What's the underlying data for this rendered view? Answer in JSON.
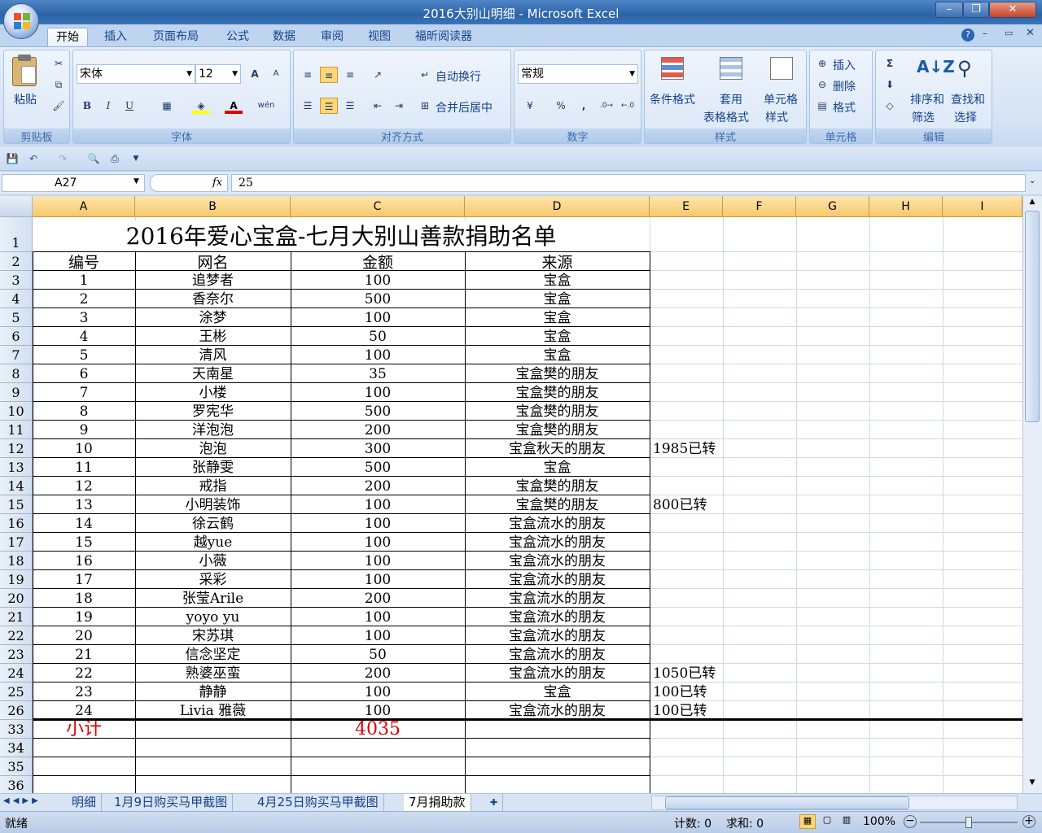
{
  "window": {
    "title": "2016大别山明细 - Microsoft Excel"
  },
  "ribbon_tabs": [
    "开始",
    "插入",
    "页面布局",
    "公式",
    "数据",
    "审阅",
    "视图",
    "福昕阅读器"
  ],
  "ribbon": {
    "clipboard": {
      "label": "剪贴板",
      "paste": "粘贴"
    },
    "font": {
      "label": "字体",
      "name": "宋体",
      "size": "12",
      "bold": "B",
      "italic": "I",
      "underline": "U",
      "grow": "A",
      "shrink": "A",
      "phonetic": "wén"
    },
    "align": {
      "label": "对齐方式",
      "wrap": "自动换行",
      "merge": "合并后居中"
    },
    "number": {
      "label": "数字",
      "format": "常规",
      "percent": "%",
      "comma": ","
    },
    "styles": {
      "label": "样式",
      "cond": "条件格式",
      "table1": "套用",
      "table2": "表格格式",
      "cell1": "单元格",
      "cell2": "样式"
    },
    "cells": {
      "label": "单元格",
      "insert": "插入",
      "delete": "删除",
      "format": "格式"
    },
    "edit": {
      "label": "编辑",
      "sort1": "排序和",
      "sort2": "筛选",
      "find1": "查找和",
      "find2": "选择",
      "sigma": "Σ"
    }
  },
  "formula_bar": {
    "name_box": "A27",
    "fx": "fx",
    "value": "25"
  },
  "columns": [
    "A",
    "B",
    "C",
    "D",
    "E",
    "F",
    "G",
    "H",
    "I"
  ],
  "sheet": {
    "title": "2016年爱心宝盒-七月大别山善款捐助名单",
    "headers": [
      "编号",
      "网名",
      "金额",
      "来源"
    ],
    "rows": [
      {
        "row": "3",
        "no": "1",
        "name": "追梦者",
        "amount": "100",
        "source": "宝盒",
        "note": ""
      },
      {
        "row": "4",
        "no": "2",
        "name": "香奈尔",
        "amount": "500",
        "source": "宝盒",
        "note": ""
      },
      {
        "row": "5",
        "no": "3",
        "name": "涂梦",
        "amount": "100",
        "source": "宝盒",
        "note": ""
      },
      {
        "row": "6",
        "no": "4",
        "name": "王彬",
        "amount": "50",
        "source": "宝盒",
        "note": ""
      },
      {
        "row": "7",
        "no": "5",
        "name": "清风",
        "amount": "100",
        "source": "宝盒",
        "note": ""
      },
      {
        "row": "8",
        "no": "6",
        "name": "天南星",
        "amount": "35",
        "source": "宝盒樊的朋友",
        "note": ""
      },
      {
        "row": "9",
        "no": "7",
        "name": "小楼",
        "amount": "100",
        "source": "宝盒樊的朋友",
        "note": ""
      },
      {
        "row": "10",
        "no": "8",
        "name": "罗宪华",
        "amount": "500",
        "source": "宝盒樊的朋友",
        "note": ""
      },
      {
        "row": "11",
        "no": "9",
        "name": "洋泡泡",
        "amount": "200",
        "source": "宝盒樊的朋友",
        "note": ""
      },
      {
        "row": "12",
        "no": "10",
        "name": "泡泡",
        "amount": "300",
        "source": "宝盒秋天的朋友",
        "note": "1985已转"
      },
      {
        "row": "13",
        "no": "11",
        "name": "张静雯",
        "amount": "500",
        "source": "宝盒",
        "note": ""
      },
      {
        "row": "14",
        "no": "12",
        "name": "戒指",
        "amount": "200",
        "source": "宝盒樊的朋友",
        "note": ""
      },
      {
        "row": "15",
        "no": "13",
        "name": "小明装饰",
        "amount": "100",
        "source": "宝盒樊的朋友",
        "note": "800已转"
      },
      {
        "row": "16",
        "no": "14",
        "name": "徐云鹤",
        "amount": "100",
        "source": "宝盒流水的朋友",
        "note": ""
      },
      {
        "row": "17",
        "no": "15",
        "name": "越yue",
        "amount": "100",
        "source": "宝盒流水的朋友",
        "note": ""
      },
      {
        "row": "18",
        "no": "16",
        "name": "小薇",
        "amount": "100",
        "source": "宝盒流水的朋友",
        "note": ""
      },
      {
        "row": "19",
        "no": "17",
        "name": "采彩",
        "amount": "100",
        "source": "宝盒流水的朋友",
        "note": ""
      },
      {
        "row": "20",
        "no": "18",
        "name": "张莹Arile",
        "amount": "200",
        "source": "宝盒流水的朋友",
        "note": ""
      },
      {
        "row": "21",
        "no": "19",
        "name": "yoyo yu",
        "amount": "100",
        "source": "宝盒流水的朋友",
        "note": ""
      },
      {
        "row": "22",
        "no": "20",
        "name": "宋苏琪",
        "amount": "100",
        "source": "宝盒流水的朋友",
        "note": ""
      },
      {
        "row": "23",
        "no": "21",
        "name": "信念坚定",
        "amount": "50",
        "source": "宝盒流水的朋友",
        "note": ""
      },
      {
        "row": "24",
        "no": "22",
        "name": "熟婆巫蛮",
        "amount": "200",
        "source": "宝盒流水的朋友",
        "note": "1050已转"
      },
      {
        "row": "25",
        "no": "23",
        "name": "静静",
        "amount": "100",
        "source": "宝盒",
        "note": "100已转"
      },
      {
        "row": "26",
        "no": "24",
        "name": "Livia 雅薇",
        "amount": "100",
        "source": "宝盒流水的朋友",
        "note": "100已转"
      }
    ],
    "subtotal": {
      "row": "33",
      "label": "小计",
      "amount": "4035"
    },
    "extra_rows": [
      "34",
      "35",
      "36"
    ]
  },
  "sheet_tabs": [
    "明细",
    "1月9日购买马甲截图",
    "4月25日购买马甲截图",
    "7月捐助款"
  ],
  "active_sheet": "7月捐助款",
  "status": {
    "ready": "就绪",
    "count": "计数: 0",
    "sum": "求和: 0",
    "zoom": "100%"
  },
  "colors": {
    "accent": "#15428b",
    "red": "#e00000",
    "header_orange": "#f7c96a"
  }
}
